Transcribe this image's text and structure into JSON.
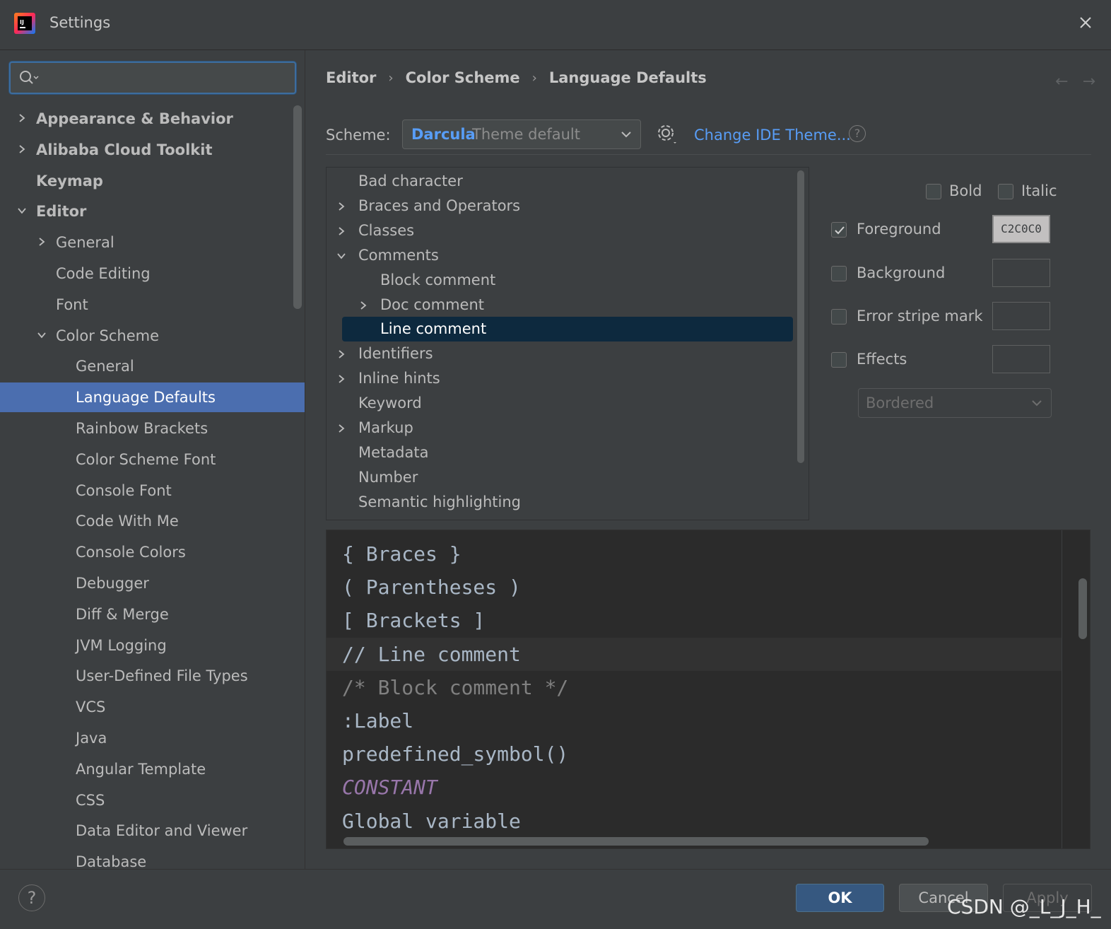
{
  "window": {
    "title": "Settings"
  },
  "sidebar": {
    "search_placeholder": "",
    "items": [
      {
        "label": "Appearance & Behavior",
        "level": 0,
        "chevron": "right",
        "bold": true
      },
      {
        "label": "Alibaba Cloud Toolkit",
        "level": 0,
        "chevron": "right",
        "bold": true
      },
      {
        "label": "Keymap",
        "level": 0,
        "chevron": "none",
        "bold": true
      },
      {
        "label": "Editor",
        "level": 0,
        "chevron": "down",
        "bold": true
      },
      {
        "label": "General",
        "level": 1,
        "chevron": "right"
      },
      {
        "label": "Code Editing",
        "level": 1,
        "chevron": "none"
      },
      {
        "label": "Font",
        "level": 1,
        "chevron": "none"
      },
      {
        "label": "Color Scheme",
        "level": 1,
        "chevron": "down"
      },
      {
        "label": "General",
        "level": 2,
        "chevron": "none"
      },
      {
        "label": "Language Defaults",
        "level": 2,
        "chevron": "none",
        "selected": true
      },
      {
        "label": "Rainbow Brackets",
        "level": 2,
        "chevron": "none"
      },
      {
        "label": "Color Scheme Font",
        "level": 2,
        "chevron": "none"
      },
      {
        "label": "Console Font",
        "level": 2,
        "chevron": "none"
      },
      {
        "label": "Code With Me",
        "level": 2,
        "chevron": "none"
      },
      {
        "label": "Console Colors",
        "level": 2,
        "chevron": "none"
      },
      {
        "label": "Debugger",
        "level": 2,
        "chevron": "none"
      },
      {
        "label": "Diff & Merge",
        "level": 2,
        "chevron": "none"
      },
      {
        "label": "JVM Logging",
        "level": 2,
        "chevron": "none"
      },
      {
        "label": "User-Defined File Types",
        "level": 2,
        "chevron": "none"
      },
      {
        "label": "VCS",
        "level": 2,
        "chevron": "none"
      },
      {
        "label": "Java",
        "level": 2,
        "chevron": "none"
      },
      {
        "label": "Angular Template",
        "level": 2,
        "chevron": "none"
      },
      {
        "label": "CSS",
        "level": 2,
        "chevron": "none"
      },
      {
        "label": "Data Editor and Viewer",
        "level": 2,
        "chevron": "none"
      },
      {
        "label": "Database",
        "level": 2,
        "chevron": "none"
      }
    ]
  },
  "breadcrumb": [
    "Editor",
    "Color Scheme",
    "Language Defaults"
  ],
  "nav": {
    "back": "←",
    "forward": "→"
  },
  "scheme": {
    "label": "Scheme:",
    "selected_name": "Darcula",
    "selected_sub": "Theme default",
    "change_theme_link": "Change IDE Theme...",
    "help": "?"
  },
  "attributes": [
    {
      "label": "Bad character",
      "level": 0,
      "chevron": "none"
    },
    {
      "label": "Braces and Operators",
      "level": 0,
      "chevron": "right"
    },
    {
      "label": "Classes",
      "level": 0,
      "chevron": "right"
    },
    {
      "label": "Comments",
      "level": 0,
      "chevron": "down"
    },
    {
      "label": "Block comment",
      "level": 1,
      "chevron": "none"
    },
    {
      "label": "Doc comment",
      "level": 1,
      "chevron": "right"
    },
    {
      "label": "Line comment",
      "level": 1,
      "chevron": "none",
      "selected": true
    },
    {
      "label": "Identifiers",
      "level": 0,
      "chevron": "right"
    },
    {
      "label": "Inline hints",
      "level": 0,
      "chevron": "right"
    },
    {
      "label": "Keyword",
      "level": 0,
      "chevron": "none"
    },
    {
      "label": "Markup",
      "level": 0,
      "chevron": "right"
    },
    {
      "label": "Metadata",
      "level": 0,
      "chevron": "none"
    },
    {
      "label": "Number",
      "level": 0,
      "chevron": "none"
    },
    {
      "label": "Semantic highlighting",
      "level": 0,
      "chevron": "none"
    }
  ],
  "options": {
    "bold_label": "Bold",
    "bold_checked": false,
    "italic_label": "Italic",
    "italic_checked": false,
    "foreground_label": "Foreground",
    "foreground_checked": true,
    "foreground_value": "C2C0C0",
    "background_label": "Background",
    "background_checked": false,
    "error_stripe_label": "Error stripe mark",
    "error_stripe_checked": false,
    "effects_label": "Effects",
    "effects_checked": false,
    "effect_type": "Bordered"
  },
  "preview": {
    "lines": [
      {
        "text": "{ Braces }",
        "style": "normal"
      },
      {
        "text": "( Parentheses )",
        "style": "normal"
      },
      {
        "text": "[ Brackets ]",
        "style": "normal"
      },
      {
        "text": "// Line comment",
        "style": "highlight"
      },
      {
        "text": "/* Block comment */",
        "style": "comment"
      },
      {
        "text": ":Label",
        "style": "normal"
      },
      {
        "text": "predefined_symbol()",
        "style": "normal"
      },
      {
        "text": "CONSTANT",
        "style": "const"
      },
      {
        "text": "Global variable",
        "style": "normal"
      }
    ]
  },
  "buttons": {
    "help": "?",
    "ok": "OK",
    "cancel": "Cancel",
    "apply": "Apply"
  },
  "watermark": "CSDN @_L_J_H_",
  "colors": {
    "accent": "#4b6eaf",
    "link": "#589df6",
    "selection_dark": "#0d293e",
    "foreground_swatch": "#c2c0c0",
    "constant": "#9876aa",
    "comment": "#808080"
  }
}
